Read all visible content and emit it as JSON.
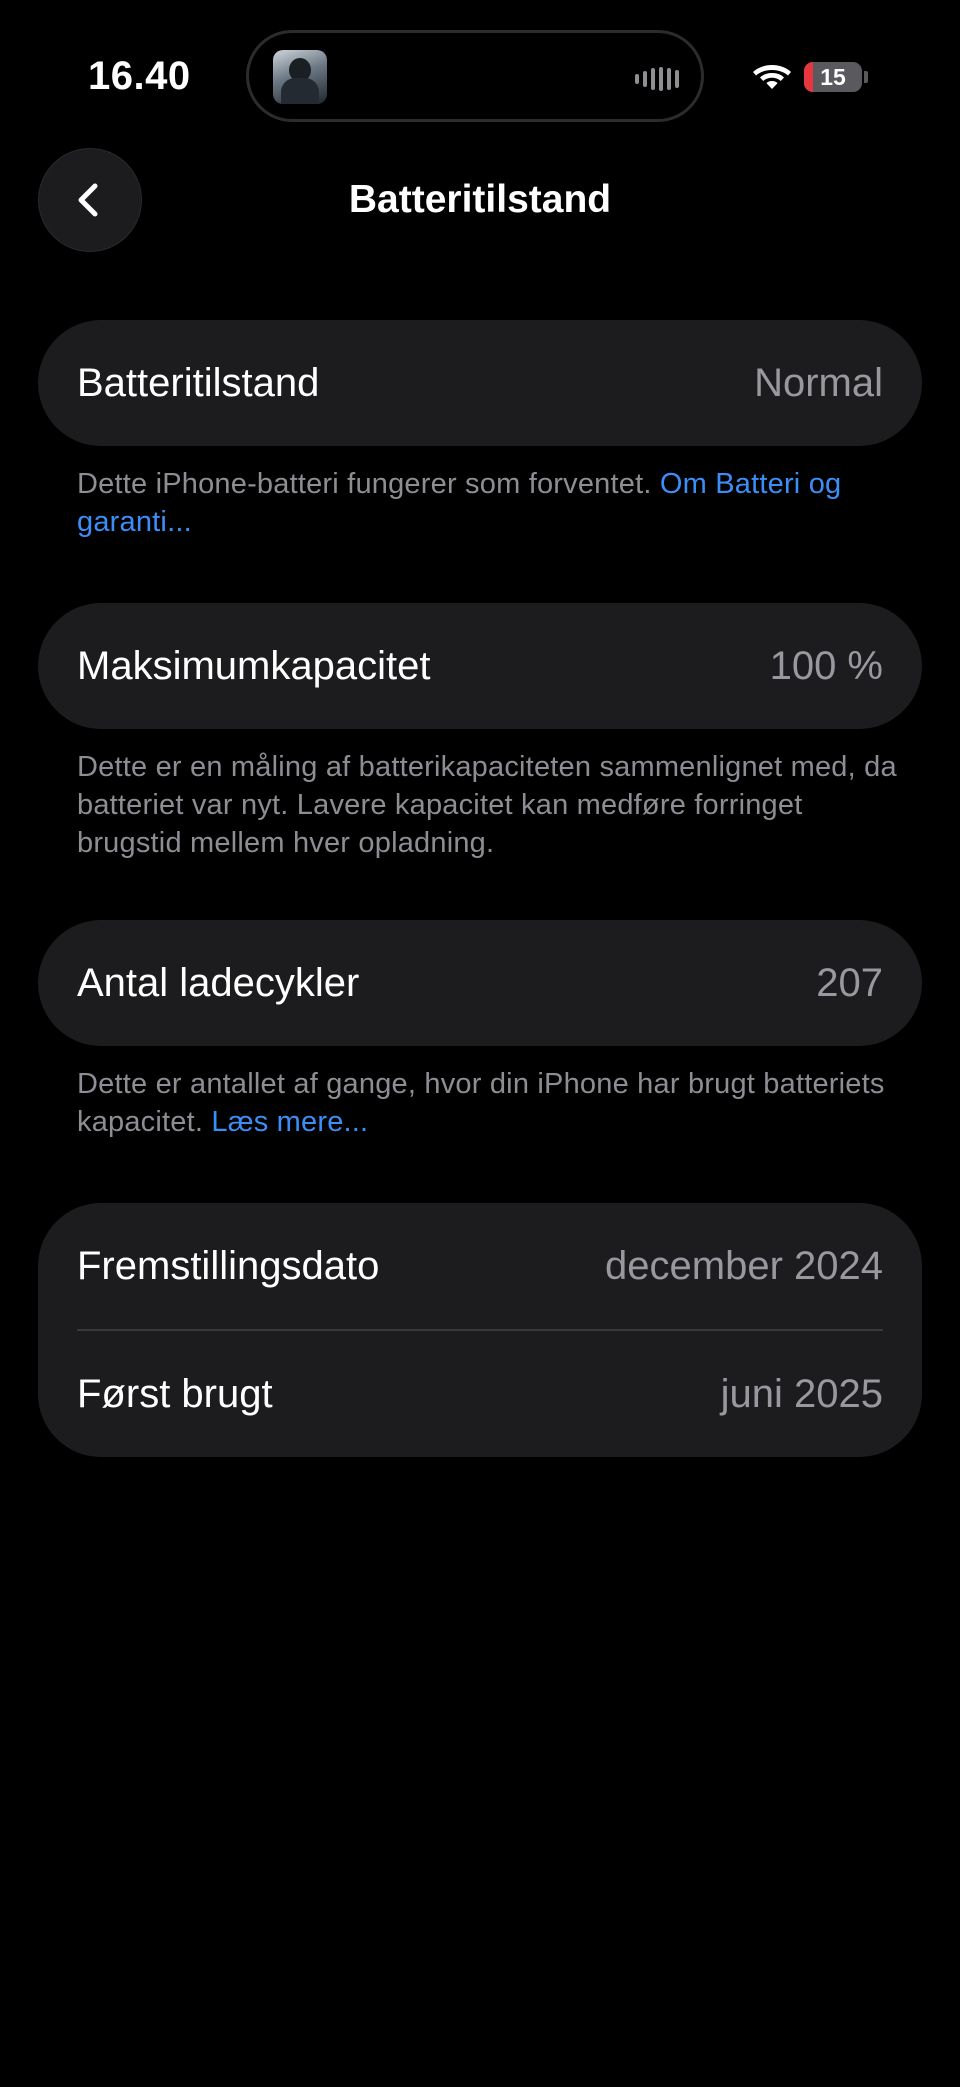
{
  "status_bar": {
    "time": "16.40",
    "battery_level": "15",
    "battery_fraction": 0.15,
    "icons": [
      "album-art-icon",
      "audio-waveform-icon",
      "wifi-icon",
      "battery-icon"
    ]
  },
  "nav": {
    "title": "Batteritilstand",
    "back_icon": "chevron-left-icon"
  },
  "sections": {
    "health": {
      "label": "Batteritilstand",
      "value": "Normal",
      "footnote_text": "Dette iPhone-batteri fungerer som forventet. ",
      "footnote_link": "Om Batteri og garanti..."
    },
    "capacity": {
      "label": "Maksimumkapacitet",
      "value": "100 %",
      "footnote_text": "Dette er en måling af batterikapaciteten sammenlignet med, da batteriet var nyt. Lavere kapacitet kan medføre forringet brugstid mellem hver opladning."
    },
    "cycles": {
      "label": "Antal ladecykler",
      "value": "207",
      "footnote_text": "Dette er antallet af gange, hvor din iPhone har brugt batteriets kapacitet. ",
      "footnote_link": "Læs mere..."
    },
    "dates": {
      "manufacture_label": "Fremstillingsdato",
      "manufacture_value": "december 2024",
      "first_use_label": "Først brugt",
      "first_use_value": "juni 2025"
    }
  },
  "colors": {
    "background": "#000000",
    "card": "#1c1c1e",
    "secondary_text": "#98989f",
    "link": "#3c8ef7",
    "battery_low": "#e5373d"
  }
}
